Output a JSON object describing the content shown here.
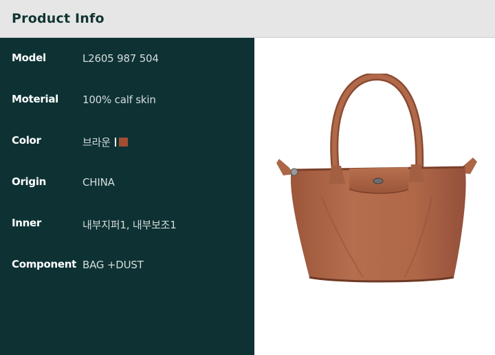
{
  "header": {
    "title": "Product Info"
  },
  "specs": [
    {
      "label": "Model",
      "value": "L2605 987 504"
    },
    {
      "label": "Moterial",
      "value": "100% calf skin"
    },
    {
      "label": "Color",
      "value": "브라운"
    },
    {
      "label": "Origin",
      "value": "CHINA"
    },
    {
      "label": "Inner",
      "value": "내부지퍼1, 내부보조1"
    },
    {
      "label": "Component",
      "value": "BAG +DUST"
    }
  ],
  "color_swatch": "#a34e33",
  "colors": {
    "header_bg": "#e6e6e6",
    "panel_bg": "#0e3234",
    "bag_leather": "#b0694a"
  },
  "product_image": {
    "icon": "tote-bag-photo"
  }
}
